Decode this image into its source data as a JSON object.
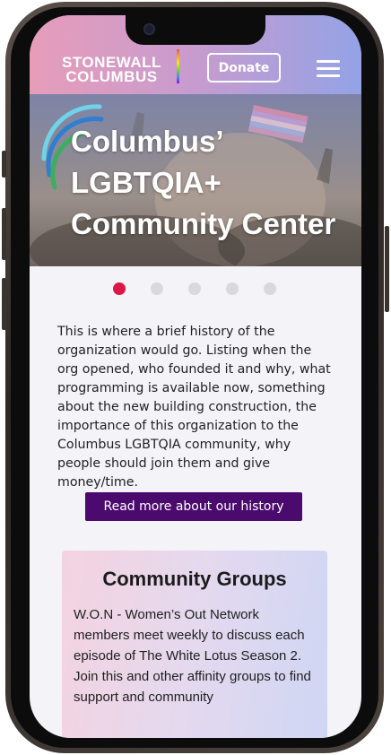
{
  "header": {
    "logo_line1": "STONEWALL",
    "logo_line2": "COLUMBUS",
    "donate_label": "Donate",
    "menu_icon": "hamburger-menu-icon"
  },
  "hero": {
    "title_line1": "Columbus’",
    "title_line2": "LGBTQIA+",
    "title_line3": "Community Center"
  },
  "carousel": {
    "slide_count": 5,
    "active_index": 0,
    "active_color": "#dc1745"
  },
  "about": {
    "text": "This is where a brief history of the organization would go. Listing when the org opened, who founded it and why, what programming is available now, something about the new building construction,  the importance of this organization to the Columbus LGBTQIA community, why people should join them and give money/time.",
    "button_label": "Read more about our history"
  },
  "community_groups": {
    "title": "Community Groups",
    "text": "W.O.N - Women’s Out Network members meet weekly to discuss each episode of The White Lotus Season 2. Join this and other affinity groups to find support and community"
  },
  "colors": {
    "header_gradient_start": "#e79db9",
    "header_gradient_end": "#93a3e6",
    "button_bg": "#4b0a6e",
    "screen_bg": "#f4f3f8"
  }
}
